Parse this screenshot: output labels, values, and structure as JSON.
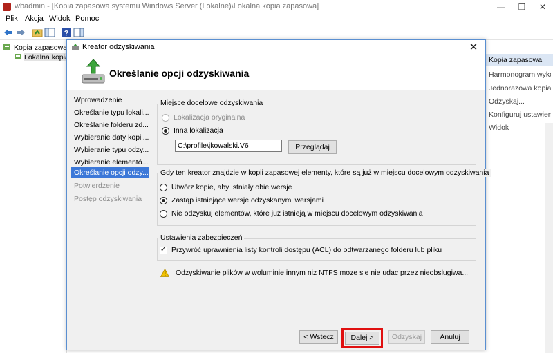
{
  "mmc": {
    "title": "wbadmin - [Kopia zapasowa systemu Windows Server (Lokalne)\\Lokalna kopia zapasowa]",
    "minimize": "—",
    "restore": "❐",
    "close": "✕",
    "menu": [
      "Plik",
      "Akcja",
      "Widok",
      "Pomoc"
    ],
    "tree": [
      "Kopia zapasowa sy",
      "Lokalna kopia"
    ],
    "actions": {
      "header": "Kopia zapasowa",
      "items": [
        "Harmonogram wykon...",
        "Jednorazowa kopia zap...",
        "Odzyskaj...",
        "Konfiguruj ustawienia ...",
        "Widok"
      ]
    }
  },
  "wizard": {
    "title": "Kreator odzyskiwania",
    "close": "✕",
    "heading": "Określanie opcji odzyskiwania",
    "steps": [
      "Wprowadzenie",
      "Określanie typu lokali...",
      "Określanie folderu zd...",
      "Wybieranie daty kopii...",
      "Wybieranie typu odzy...",
      "Wybieranie elementó...",
      "Określanie opcji odzy...",
      "Potwierdzenie",
      "Postęp odzyskiwania"
    ],
    "destination": {
      "group_title": "Miejsce docelowe odzyskiwania",
      "original_label": "Lokalizacja oryginalna",
      "other_label": "Inna lokalizacja",
      "path_value": "C:\\profile\\jkowalski.V6",
      "browse_label": "Przeglądaj"
    },
    "conflict": {
      "group_title": "Gdy ten kreator znajdzie w kopii zapasowej elementy, które są już w miejscu docelowym odzyskiwania",
      "options": [
        "Utwórz kopie, aby istniały obie wersje",
        "Zastąp istniejące wersje odzyskanymi wersjami",
        "Nie odzyskuj elementów, które już istnieją w miejscu docelowym odzyskiwania"
      ]
    },
    "security": {
      "group_title": "Ustawienia zabezpieczeń",
      "acl_label": "Przywróć uprawnienia listy kontroli dostępu (ACL) do odtwarzanego folderu lub pliku"
    },
    "warning": "Odzyskiwanie plików w woluminie innym niz NTFS moze sie nie udac przez nieobslugiwa...",
    "buttons": {
      "back": "< Wstecz",
      "next": "Dalej >",
      "recover": "Odzyskaj",
      "cancel": "Anuluj"
    }
  }
}
